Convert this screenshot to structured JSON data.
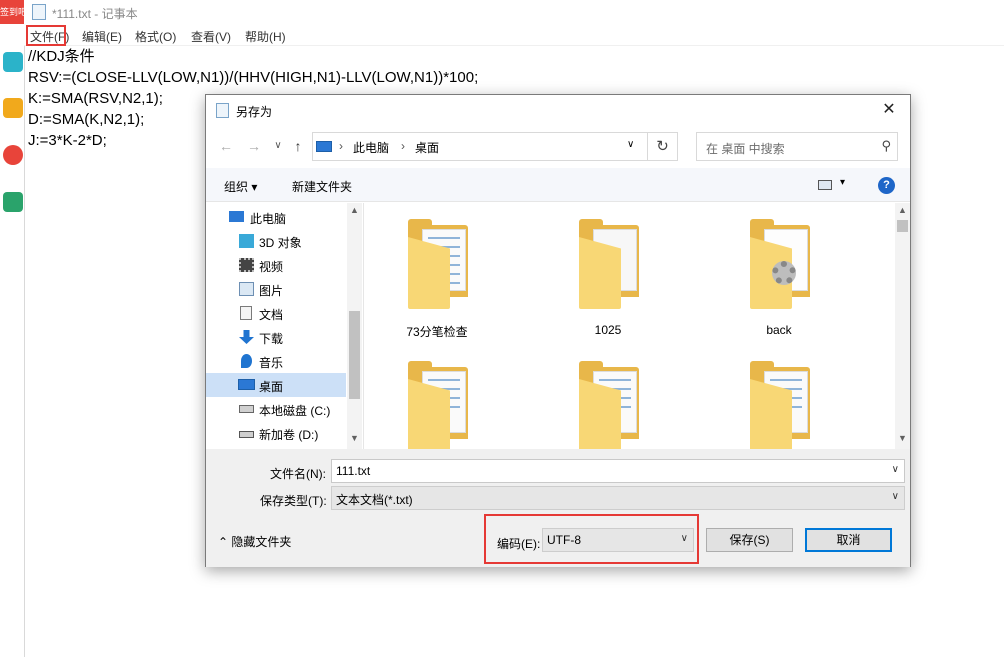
{
  "desktop": {
    "top_badge": "签到吧"
  },
  "notepad": {
    "title": "*111.txt - 记事本",
    "menu": [
      "文件(F)",
      "编辑(E)",
      "格式(O)",
      "查看(V)",
      "帮助(H)"
    ],
    "lines": [
      "//KDJ条件",
      "RSV:=(CLOSE-LLV(LOW,N1))/(HHV(HIGH,N1)-LLV(LOW,N1))*100;",
      "K:=SMA(RSV,N2,1);",
      "D:=SMA(K,N2,1);",
      "J:=3*K-2*D;"
    ]
  },
  "dialog": {
    "title": "另存为",
    "close": "✕",
    "nav": {
      "back": "←",
      "forward": "→",
      "dropdown": "∨",
      "up": "↑"
    },
    "address": {
      "sep": "›",
      "crumbs": [
        "此电脑",
        "桌面"
      ],
      "dropdown": "∨",
      "refresh": "↻"
    },
    "search": {
      "placeholder": "在 桌面 中搜索",
      "icon": "⚲"
    },
    "toolbar": {
      "organize": "组织 ▾",
      "new_folder": "新建文件夹",
      "view_caret": "▾",
      "help": "?"
    },
    "tree": [
      {
        "label": "此电脑",
        "icon": "pc-icon"
      },
      {
        "label": "3D 对象",
        "icon": "cube-icon"
      },
      {
        "label": "视频",
        "icon": "video-icon"
      },
      {
        "label": "图片",
        "icon": "picture-icon"
      },
      {
        "label": "文档",
        "icon": "document-icon"
      },
      {
        "label": "下载",
        "icon": "download-icon"
      },
      {
        "label": "音乐",
        "icon": "music-icon"
      },
      {
        "label": "桌面",
        "icon": "desktop-icon",
        "selected": true
      },
      {
        "label": "本地磁盘 (C:)",
        "icon": "drive-icon"
      },
      {
        "label": "新加卷 (D:)",
        "icon": "drive-icon"
      }
    ],
    "scroll_arrows": {
      "up": "▲",
      "down": "▼"
    },
    "files": [
      {
        "name": "73分笔检查",
        "kind": "docs"
      },
      {
        "name": "1025",
        "kind": "pages"
      },
      {
        "name": "back",
        "kind": "settings"
      },
      {
        "name": "",
        "kind": "docs"
      },
      {
        "name": "",
        "kind": "docs"
      },
      {
        "name": "",
        "kind": "docs"
      }
    ],
    "filename_label": "文件名(N):",
    "filename_value": "111.txt",
    "filetype_label": "保存类型(T):",
    "filetype_value": "文本文档(*.txt)",
    "field_dropdown": "∨",
    "encoding_label": "编码(E):",
    "encoding_value": "UTF-8",
    "save": "保存(S)",
    "cancel": "取消",
    "hide_folders": "⌃ 隐藏文件夹"
  }
}
